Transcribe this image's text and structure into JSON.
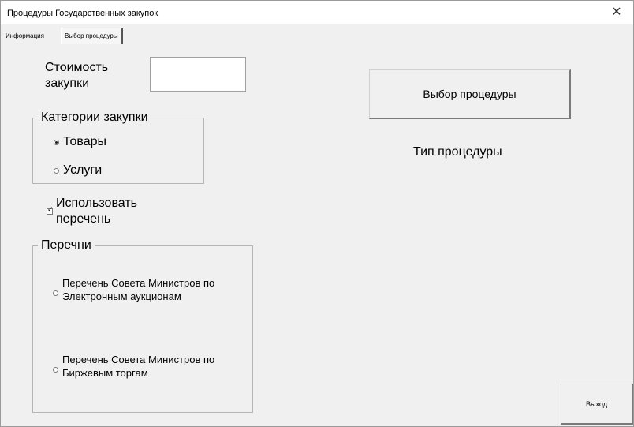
{
  "window": {
    "title": "Процедуры Государственных закупок",
    "close_symbol": "✕"
  },
  "tabs": [
    {
      "label": "Информация",
      "active": false
    },
    {
      "label": "Выбор процедуры",
      "active": true
    }
  ],
  "form": {
    "cost_label": "Стоимость закупки",
    "cost_value": "",
    "category_group": {
      "legend": "Категории закупки",
      "options": [
        {
          "label": "Товары",
          "selected": true
        },
        {
          "label": "Услуги",
          "selected": false
        }
      ]
    },
    "use_list": {
      "label": "Использовать перечень",
      "checked": true,
      "check_symbol": "✓"
    },
    "lists_group": {
      "legend": "Перечни",
      "options": [
        {
          "label": "Перечень Совета Министров по Электронным аукционам",
          "selected": false
        },
        {
          "label": "Перечень Совета Министров по Биржевым торгам",
          "selected": false
        }
      ]
    }
  },
  "actions": {
    "select_procedure": "Выбор процедуры",
    "procedure_type": "Тип процедуры",
    "exit": "Выход"
  }
}
